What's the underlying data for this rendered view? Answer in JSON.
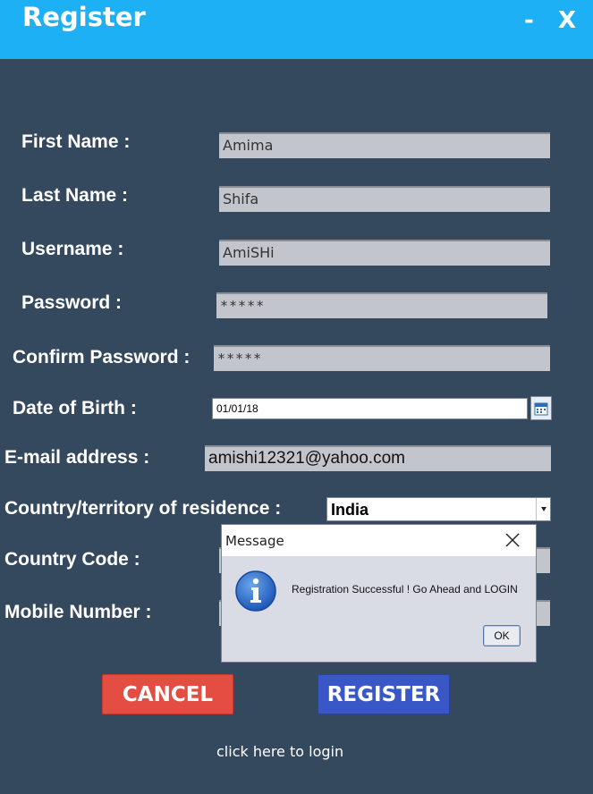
{
  "window": {
    "title": "Register",
    "minimize_label": "-",
    "close_label": "X"
  },
  "form": {
    "first_name": {
      "label": "First Name :",
      "value": "Amima"
    },
    "last_name": {
      "label": "Last Name :",
      "value": "Shifa"
    },
    "username": {
      "label": "Username :",
      "value": "AmiSHi"
    },
    "password": {
      "label": "Password :",
      "value": "*****"
    },
    "confirm_password": {
      "label": "Confirm Password :",
      "value": "*****"
    },
    "date_of_birth": {
      "label": "Date of Birth :",
      "value": "01/01/18"
    },
    "email": {
      "label": "E-mail address :",
      "value": "amishi12321@yahoo.com"
    },
    "country": {
      "label": "Country/territory of residence :",
      "selected": "India"
    },
    "country_code": {
      "label": "Country Code  :",
      "value": ""
    },
    "mobile_number": {
      "label": "Mobile Number :",
      "value": ""
    }
  },
  "buttons": {
    "cancel": "CANCEL",
    "register": "REGISTER"
  },
  "login_link": "click here to login",
  "dialog": {
    "title": "Message",
    "message": "Registration Successful ! Go Ahead and LOGIN",
    "ok": "OK",
    "icon": "info-icon"
  },
  "colors": {
    "background": "#34495e",
    "titlebar": "#1eb0f5",
    "cancel": "#e44d41",
    "register": "#3a57c8"
  }
}
